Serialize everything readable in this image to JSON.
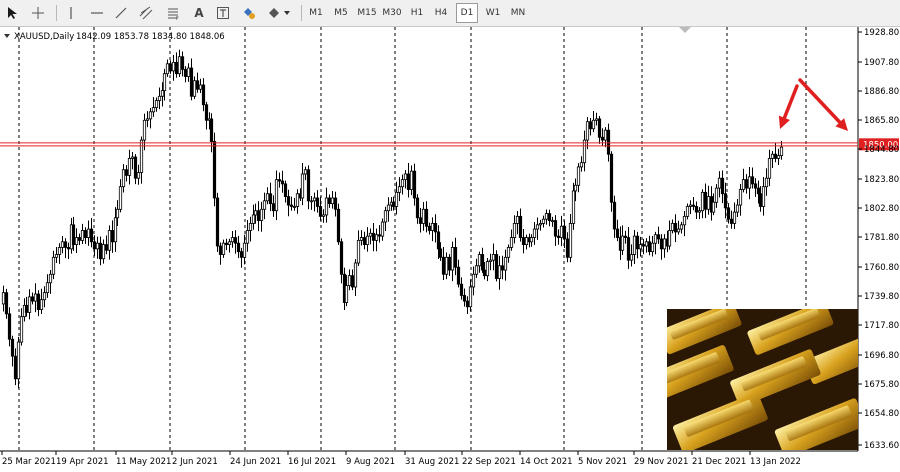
{
  "toolbar": {
    "timeframes": [
      "M1",
      "M5",
      "M15",
      "M30",
      "H1",
      "H4",
      "D1",
      "W1",
      "MN"
    ],
    "active_timeframe": "D1",
    "text_tool_label": "A",
    "draw_tool_icons": [
      "cursor-arrow-icon",
      "crosshair-icon",
      "vertical-line-icon",
      "horizontal-line-icon",
      "trendline-icon",
      "channel-icon",
      "fibonacci-icon",
      "text-icon",
      "text-label-icon",
      "shapes-icon"
    ]
  },
  "chart_info": {
    "symbol": "XAUUSD,Daily",
    "ohlc": "1842.09 1853.78 1834.80 1848.06"
  },
  "colors": {
    "candle": "#000000",
    "grid": "#000000",
    "price_line": "#e02020",
    "price_label_bg": "#e02020",
    "arrow": "#e02020"
  },
  "chart_data": {
    "type": "candlestick",
    "title": "XAUUSD,Daily",
    "xlabel": "",
    "ylabel": "",
    "y_ticks": [
      "1928.80",
      "1907.80",
      "1886.80",
      "1865.80",
      "1844.80",
      "1823.80",
      "1802.80",
      "1781.80",
      "1760.80",
      "1739.80",
      "1717.80",
      "1696.80",
      "1675.80",
      "1654.80",
      "1633.60"
    ],
    "ylim": [
      1633.6,
      1928.8
    ],
    "x_ticks": [
      "25 Mar 2021",
      "19 Apr 2021",
      "11 May 2021",
      "2 Jun 2021",
      "24 Jun 2021",
      "16 Jul 2021",
      "9 Aug 2021",
      "31 Aug 2021",
      "22 Sep 2021",
      "14 Oct 2021",
      "5 Nov 2021",
      "29 Nov 2021",
      "21 Dec 2021",
      "13 Jan 2022"
    ],
    "current_price_label": "1850.00",
    "current_price": 1850.0,
    "grid": "vertical-dashed",
    "close_series": [
      1745,
      1730,
      1712,
      1700,
      1684,
      1710,
      1728,
      1736,
      1731,
      1742,
      1739,
      1744,
      1733,
      1740,
      1745,
      1752,
      1758,
      1770,
      1772,
      1777,
      1781,
      1777,
      1776,
      1793,
      1779,
      1784,
      1782,
      1789,
      1784,
      1790,
      1781,
      1776,
      1780,
      1769,
      1779,
      1775,
      1789,
      1781,
      1798,
      1804,
      1820,
      1832,
      1828,
      1840,
      1841,
      1826,
      1830,
      1853,
      1867,
      1868,
      1873,
      1876,
      1881,
      1884,
      1888,
      1900,
      1907,
      1902,
      1908,
      1900,
      1912,
      1903,
      1898,
      1904,
      1884,
      1895,
      1889,
      1892,
      1878,
      1867,
      1868,
      1852,
      1812,
      1778,
      1772,
      1780,
      1779,
      1781,
      1784,
      1780,
      1774,
      1770,
      1780,
      1789,
      1794,
      1800,
      1803,
      1796,
      1804,
      1810,
      1815,
      1808,
      1803,
      1825,
      1824,
      1822,
      1813,
      1807,
      1806,
      1806,
      1815,
      1812,
      1829,
      1832,
      1810,
      1810,
      1812,
      1806,
      1799,
      1800,
      1812,
      1808,
      1812,
      1804,
      1781,
      1758,
      1738,
      1750,
      1757,
      1749,
      1766,
      1782,
      1784,
      1779,
      1785,
      1787,
      1782,
      1786,
      1785,
      1795,
      1803,
      1807,
      1809,
      1806,
      1816,
      1820,
      1825,
      1829,
      1818,
      1831,
      1812,
      1798,
      1794,
      1804,
      1792,
      1789,
      1794,
      1788,
      1776,
      1770,
      1758,
      1770,
      1761,
      1777,
      1763,
      1751,
      1743,
      1739,
      1735,
      1749,
      1758,
      1764,
      1772,
      1761,
      1757,
      1767,
      1768,
      1772,
      1755,
      1764,
      1761,
      1770,
      1777,
      1784,
      1794,
      1799,
      1784,
      1779,
      1784,
      1781,
      1784,
      1790,
      1793,
      1794,
      1797,
      1801,
      1796,
      1796,
      1785,
      1784,
      1792,
      1783,
      1770,
      1794,
      1817,
      1821,
      1834,
      1837,
      1853,
      1866,
      1861,
      1867,
      1868,
      1855,
      1853,
      1860,
      1843,
      1809,
      1790,
      1784,
      1775,
      1785,
      1784,
      1768,
      1772,
      1785,
      1776,
      1779,
      1778,
      1781,
      1774,
      1780,
      1786,
      1783,
      1776,
      1783,
      1778,
      1789,
      1794,
      1788,
      1790,
      1793,
      1799,
      1806,
      1807,
      1806,
      1802,
      1803,
      1816,
      1804,
      1813,
      1802,
      1809,
      1819,
      1826,
      1815,
      1805,
      1797,
      1794,
      1802,
      1807,
      1818,
      1825,
      1819,
      1827,
      1822,
      1819,
      1815,
      1806,
      1820,
      1826,
      1840,
      1843,
      1840,
      1842,
      1848
    ]
  },
  "annotations": {
    "arrows": [
      "up-to-current-price",
      "down-from-resistance"
    ],
    "image_overlay": "gold-bars-photo"
  }
}
